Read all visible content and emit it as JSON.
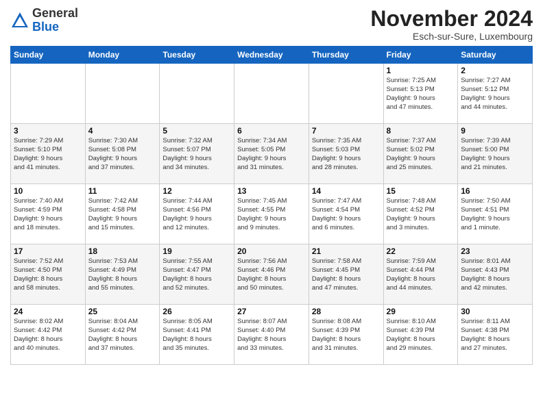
{
  "logo": {
    "general": "General",
    "blue": "Blue"
  },
  "title": "November 2024",
  "subtitle": "Esch-sur-Sure, Luxembourg",
  "days_of_week": [
    "Sunday",
    "Monday",
    "Tuesday",
    "Wednesday",
    "Thursday",
    "Friday",
    "Saturday"
  ],
  "weeks": [
    [
      {
        "day": "",
        "info": ""
      },
      {
        "day": "",
        "info": ""
      },
      {
        "day": "",
        "info": ""
      },
      {
        "day": "",
        "info": ""
      },
      {
        "day": "",
        "info": ""
      },
      {
        "day": "1",
        "info": "Sunrise: 7:25 AM\nSunset: 5:13 PM\nDaylight: 9 hours\nand 47 minutes."
      },
      {
        "day": "2",
        "info": "Sunrise: 7:27 AM\nSunset: 5:12 PM\nDaylight: 9 hours\nand 44 minutes."
      }
    ],
    [
      {
        "day": "3",
        "info": "Sunrise: 7:29 AM\nSunset: 5:10 PM\nDaylight: 9 hours\nand 41 minutes."
      },
      {
        "day": "4",
        "info": "Sunrise: 7:30 AM\nSunset: 5:08 PM\nDaylight: 9 hours\nand 37 minutes."
      },
      {
        "day": "5",
        "info": "Sunrise: 7:32 AM\nSunset: 5:07 PM\nDaylight: 9 hours\nand 34 minutes."
      },
      {
        "day": "6",
        "info": "Sunrise: 7:34 AM\nSunset: 5:05 PM\nDaylight: 9 hours\nand 31 minutes."
      },
      {
        "day": "7",
        "info": "Sunrise: 7:35 AM\nSunset: 5:03 PM\nDaylight: 9 hours\nand 28 minutes."
      },
      {
        "day": "8",
        "info": "Sunrise: 7:37 AM\nSunset: 5:02 PM\nDaylight: 9 hours\nand 25 minutes."
      },
      {
        "day": "9",
        "info": "Sunrise: 7:39 AM\nSunset: 5:00 PM\nDaylight: 9 hours\nand 21 minutes."
      }
    ],
    [
      {
        "day": "10",
        "info": "Sunrise: 7:40 AM\nSunset: 4:59 PM\nDaylight: 9 hours\nand 18 minutes."
      },
      {
        "day": "11",
        "info": "Sunrise: 7:42 AM\nSunset: 4:58 PM\nDaylight: 9 hours\nand 15 minutes."
      },
      {
        "day": "12",
        "info": "Sunrise: 7:44 AM\nSunset: 4:56 PM\nDaylight: 9 hours\nand 12 minutes."
      },
      {
        "day": "13",
        "info": "Sunrise: 7:45 AM\nSunset: 4:55 PM\nDaylight: 9 hours\nand 9 minutes."
      },
      {
        "day": "14",
        "info": "Sunrise: 7:47 AM\nSunset: 4:54 PM\nDaylight: 9 hours\nand 6 minutes."
      },
      {
        "day": "15",
        "info": "Sunrise: 7:48 AM\nSunset: 4:52 PM\nDaylight: 9 hours\nand 3 minutes."
      },
      {
        "day": "16",
        "info": "Sunrise: 7:50 AM\nSunset: 4:51 PM\nDaylight: 9 hours\nand 1 minute."
      }
    ],
    [
      {
        "day": "17",
        "info": "Sunrise: 7:52 AM\nSunset: 4:50 PM\nDaylight: 8 hours\nand 58 minutes."
      },
      {
        "day": "18",
        "info": "Sunrise: 7:53 AM\nSunset: 4:49 PM\nDaylight: 8 hours\nand 55 minutes."
      },
      {
        "day": "19",
        "info": "Sunrise: 7:55 AM\nSunset: 4:47 PM\nDaylight: 8 hours\nand 52 minutes."
      },
      {
        "day": "20",
        "info": "Sunrise: 7:56 AM\nSunset: 4:46 PM\nDaylight: 8 hours\nand 50 minutes."
      },
      {
        "day": "21",
        "info": "Sunrise: 7:58 AM\nSunset: 4:45 PM\nDaylight: 8 hours\nand 47 minutes."
      },
      {
        "day": "22",
        "info": "Sunrise: 7:59 AM\nSunset: 4:44 PM\nDaylight: 8 hours\nand 44 minutes."
      },
      {
        "day": "23",
        "info": "Sunrise: 8:01 AM\nSunset: 4:43 PM\nDaylight: 8 hours\nand 42 minutes."
      }
    ],
    [
      {
        "day": "24",
        "info": "Sunrise: 8:02 AM\nSunset: 4:42 PM\nDaylight: 8 hours\nand 40 minutes."
      },
      {
        "day": "25",
        "info": "Sunrise: 8:04 AM\nSunset: 4:42 PM\nDaylight: 8 hours\nand 37 minutes."
      },
      {
        "day": "26",
        "info": "Sunrise: 8:05 AM\nSunset: 4:41 PM\nDaylight: 8 hours\nand 35 minutes."
      },
      {
        "day": "27",
        "info": "Sunrise: 8:07 AM\nSunset: 4:40 PM\nDaylight: 8 hours\nand 33 minutes."
      },
      {
        "day": "28",
        "info": "Sunrise: 8:08 AM\nSunset: 4:39 PM\nDaylight: 8 hours\nand 31 minutes."
      },
      {
        "day": "29",
        "info": "Sunrise: 8:10 AM\nSunset: 4:39 PM\nDaylight: 8 hours\nand 29 minutes."
      },
      {
        "day": "30",
        "info": "Sunrise: 8:11 AM\nSunset: 4:38 PM\nDaylight: 8 hours\nand 27 minutes."
      }
    ]
  ]
}
